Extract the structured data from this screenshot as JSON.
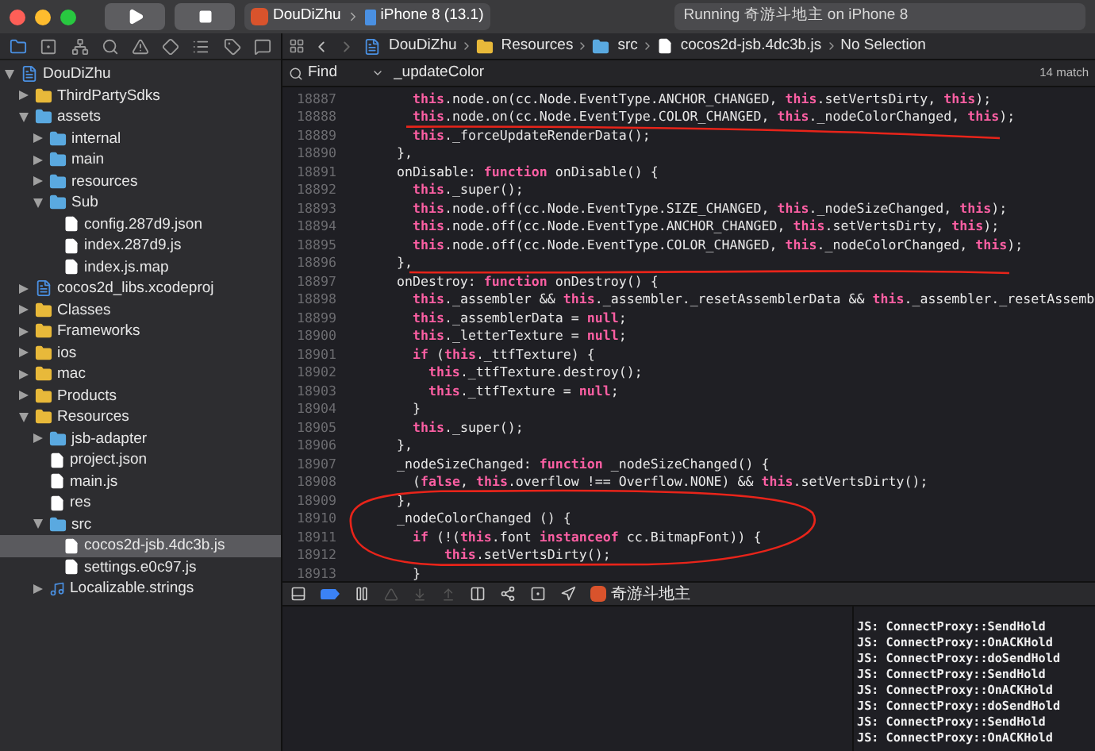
{
  "toolbar": {
    "scheme": "DouDiZhu",
    "device": "iPhone 8 (13.1)",
    "status": "Running 奇游斗地主 on iPhone 8"
  },
  "jump_bar": [
    {
      "kind": "project",
      "label": "DouDiZhu"
    },
    {
      "kind": "group",
      "label": "Resources"
    },
    {
      "kind": "folder",
      "label": "src"
    },
    {
      "kind": "file",
      "label": "cocos2d-jsb.4dc3b.js"
    },
    {
      "kind": "text",
      "label": "No Selection"
    }
  ],
  "find_bar": {
    "mode": "Find",
    "query": "_updateColor",
    "matches": "14 match"
  },
  "navigator": [
    {
      "label": "DouDiZhu",
      "kind": "project",
      "expanded": true,
      "selected": false,
      "children": [
        {
          "label": "ThirdPartySdks",
          "kind": "group",
          "expanded": false,
          "selected": false
        },
        {
          "label": "assets",
          "kind": "folder",
          "expanded": true,
          "selected": false,
          "children": [
            {
              "label": "internal",
              "kind": "folder",
              "expanded": false,
              "selected": false
            },
            {
              "label": "main",
              "kind": "folder",
              "expanded": false,
              "selected": false
            },
            {
              "label": "resources",
              "kind": "folder",
              "expanded": false,
              "selected": false
            },
            {
              "label": "Sub",
              "kind": "folder",
              "expanded": true,
              "selected": false,
              "children": [
                {
                  "label": "config.287d9.json",
                  "kind": "file",
                  "selected": false
                },
                {
                  "label": "index.287d9.js",
                  "kind": "file",
                  "selected": false
                },
                {
                  "label": "index.js.map",
                  "kind": "file",
                  "selected": false
                }
              ]
            }
          ]
        },
        {
          "label": "cocos2d_libs.xcodeproj",
          "kind": "project",
          "expanded": false,
          "selected": false
        },
        {
          "label": "Classes",
          "kind": "group",
          "expanded": false,
          "selected": false
        },
        {
          "label": "Frameworks",
          "kind": "group",
          "expanded": false,
          "selected": false
        },
        {
          "label": "ios",
          "kind": "group",
          "expanded": false,
          "selected": false
        },
        {
          "label": "mac",
          "kind": "group",
          "expanded": false,
          "selected": false
        },
        {
          "label": "Products",
          "kind": "group",
          "expanded": false,
          "selected": false
        },
        {
          "label": "Resources",
          "kind": "group",
          "expanded": true,
          "selected": false,
          "children": [
            {
              "label": "jsb-adapter",
              "kind": "folder",
              "expanded": false,
              "selected": false
            },
            {
              "label": "project.json",
              "kind": "file",
              "selected": false
            },
            {
              "label": "main.js",
              "kind": "file",
              "selected": false
            },
            {
              "label": "res",
              "kind": "file",
              "selected": false
            },
            {
              "label": "src",
              "kind": "folder",
              "expanded": true,
              "selected": false,
              "children": [
                {
                  "label": "cocos2d-jsb.4dc3b.js",
                  "kind": "file",
                  "selected": true
                },
                {
                  "label": "settings.e0c97.js",
                  "kind": "file",
                  "selected": false
                }
              ]
            },
            {
              "label": "Localizable.strings",
              "kind": "strings",
              "expanded": false,
              "selected": false
            }
          ]
        }
      ]
    }
  ],
  "code_lines": [
    {
      "number": "18887",
      "tokens": [
        {
          "kind": "keyword",
          "text": "        this"
        },
        {
          "kind": "plain",
          "text": ".node.on(cc.Node.EventType.ANCHOR_CHANGED, "
        },
        {
          "kind": "keyword",
          "text": "this"
        },
        {
          "kind": "plain",
          "text": ".setVertsDirty, "
        },
        {
          "kind": "keyword",
          "text": "this"
        },
        {
          "kind": "plain",
          "text": ");"
        }
      ]
    },
    {
      "number": "18888",
      "tokens": [
        {
          "kind": "keyword",
          "text": "        this"
        },
        {
          "kind": "plain",
          "text": ".node.on(cc.Node.EventType.COLOR_CHANGED, "
        },
        {
          "kind": "keyword",
          "text": "this"
        },
        {
          "kind": "plain",
          "text": "._nodeColorChanged, "
        },
        {
          "kind": "keyword",
          "text": "this"
        },
        {
          "kind": "plain",
          "text": ");"
        }
      ]
    },
    {
      "number": "18889",
      "tokens": [
        {
          "kind": "keyword",
          "text": "        this"
        },
        {
          "kind": "plain",
          "text": "._forceUpdateRenderData();"
        }
      ]
    },
    {
      "number": "18890",
      "tokens": [
        {
          "kind": "plain",
          "text": "      },"
        }
      ]
    },
    {
      "number": "18891",
      "tokens": [
        {
          "kind": "plain",
          "text": "      onDisable: "
        },
        {
          "kind": "keyword",
          "text": "function"
        },
        {
          "kind": "plain",
          "text": " onDisable() {"
        }
      ]
    },
    {
      "number": "18892",
      "tokens": [
        {
          "kind": "keyword",
          "text": "        this"
        },
        {
          "kind": "plain",
          "text": "._super();"
        }
      ]
    },
    {
      "number": "18893",
      "tokens": [
        {
          "kind": "keyword",
          "text": "        this"
        },
        {
          "kind": "plain",
          "text": ".node.off(cc.Node.EventType.SIZE_CHANGED, "
        },
        {
          "kind": "keyword",
          "text": "this"
        },
        {
          "kind": "plain",
          "text": "._nodeSizeChanged, "
        },
        {
          "kind": "keyword",
          "text": "this"
        },
        {
          "kind": "plain",
          "text": ");"
        }
      ]
    },
    {
      "number": "18894",
      "tokens": [
        {
          "kind": "keyword",
          "text": "        this"
        },
        {
          "kind": "plain",
          "text": ".node.off(cc.Node.EventType.ANCHOR_CHANGED, "
        },
        {
          "kind": "keyword",
          "text": "this"
        },
        {
          "kind": "plain",
          "text": ".setVertsDirty, "
        },
        {
          "kind": "keyword",
          "text": "this"
        },
        {
          "kind": "plain",
          "text": ");"
        }
      ]
    },
    {
      "number": "18895",
      "tokens": [
        {
          "kind": "keyword",
          "text": "        this"
        },
        {
          "kind": "plain",
          "text": ".node.off(cc.Node.EventType.COLOR_CHANGED, "
        },
        {
          "kind": "keyword",
          "text": "this"
        },
        {
          "kind": "plain",
          "text": "._nodeColorChanged, "
        },
        {
          "kind": "keyword",
          "text": "this"
        },
        {
          "kind": "plain",
          "text": ");"
        }
      ]
    },
    {
      "number": "18896",
      "tokens": [
        {
          "kind": "plain",
          "text": "      },"
        }
      ]
    },
    {
      "number": "18897",
      "tokens": [
        {
          "kind": "plain",
          "text": "      onDestroy: "
        },
        {
          "kind": "keyword",
          "text": "function"
        },
        {
          "kind": "plain",
          "text": " onDestroy() {"
        }
      ]
    },
    {
      "number": "18898",
      "tokens": [
        {
          "kind": "keyword",
          "text": "        this"
        },
        {
          "kind": "plain",
          "text": "._assembler && "
        },
        {
          "kind": "keyword",
          "text": "this"
        },
        {
          "kind": "plain",
          "text": "._assembler._resetAssemblerData && "
        },
        {
          "kind": "keyword",
          "text": "this"
        },
        {
          "kind": "plain",
          "text": "._assembler._resetAssemb"
        }
      ]
    },
    {
      "number": "18899",
      "tokens": [
        {
          "kind": "keyword",
          "text": "        this"
        },
        {
          "kind": "plain",
          "text": "._assemblerData = "
        },
        {
          "kind": "keyword",
          "text": "null"
        },
        {
          "kind": "plain",
          "text": ";"
        }
      ]
    },
    {
      "number": "18900",
      "tokens": [
        {
          "kind": "keyword",
          "text": "        this"
        },
        {
          "kind": "plain",
          "text": "._letterTexture = "
        },
        {
          "kind": "keyword",
          "text": "null"
        },
        {
          "kind": "plain",
          "text": ";"
        }
      ]
    },
    {
      "number": "18901",
      "tokens": [
        {
          "kind": "keyword",
          "text": "        if"
        },
        {
          "kind": "plain",
          "text": " ("
        },
        {
          "kind": "keyword",
          "text": "this"
        },
        {
          "kind": "plain",
          "text": "._ttfTexture) {"
        }
      ]
    },
    {
      "number": "18902",
      "tokens": [
        {
          "kind": "keyword",
          "text": "          this"
        },
        {
          "kind": "plain",
          "text": "._ttfTexture.destroy();"
        }
      ]
    },
    {
      "number": "18903",
      "tokens": [
        {
          "kind": "keyword",
          "text": "          this"
        },
        {
          "kind": "plain",
          "text": "._ttfTexture = "
        },
        {
          "kind": "keyword",
          "text": "null"
        },
        {
          "kind": "plain",
          "text": ";"
        }
      ]
    },
    {
      "number": "18904",
      "tokens": [
        {
          "kind": "plain",
          "text": "        }"
        }
      ]
    },
    {
      "number": "18905",
      "tokens": [
        {
          "kind": "keyword",
          "text": "        this"
        },
        {
          "kind": "plain",
          "text": "._super();"
        }
      ]
    },
    {
      "number": "18906",
      "tokens": [
        {
          "kind": "plain",
          "text": "      },"
        }
      ]
    },
    {
      "number": "18907",
      "tokens": [
        {
          "kind": "plain",
          "text": "      _nodeSizeChanged: "
        },
        {
          "kind": "keyword",
          "text": "function"
        },
        {
          "kind": "plain",
          "text": " _nodeSizeChanged() {"
        }
      ]
    },
    {
      "number": "18908",
      "tokens": [
        {
          "kind": "plain",
          "text": "        ("
        },
        {
          "kind": "keyword",
          "text": "false"
        },
        {
          "kind": "plain",
          "text": ", "
        },
        {
          "kind": "keyword",
          "text": "this"
        },
        {
          "kind": "plain",
          "text": ".overflow !== Overflow.NONE) && "
        },
        {
          "kind": "keyword",
          "text": "this"
        },
        {
          "kind": "plain",
          "text": ".setVertsDirty();"
        }
      ]
    },
    {
      "number": "18909",
      "tokens": [
        {
          "kind": "plain",
          "text": "      },"
        }
      ]
    },
    {
      "number": "18910",
      "tokens": [
        {
          "kind": "plain",
          "text": "      _nodeColorChanged () {"
        }
      ]
    },
    {
      "number": "18911",
      "tokens": [
        {
          "kind": "keyword",
          "text": "        if"
        },
        {
          "kind": "plain",
          "text": " (!("
        },
        {
          "kind": "keyword",
          "text": "this"
        },
        {
          "kind": "plain",
          "text": ".font "
        },
        {
          "kind": "keyword",
          "text": "instanceof"
        },
        {
          "kind": "plain",
          "text": " cc.BitmapFont)) {"
        }
      ]
    },
    {
      "number": "18912",
      "tokens": [
        {
          "kind": "keyword",
          "text": "            this"
        },
        {
          "kind": "plain",
          "text": ".setVertsDirty();"
        }
      ]
    },
    {
      "number": "18913",
      "tokens": [
        {
          "kind": "plain",
          "text": "        }"
        }
      ]
    }
  ],
  "debug_bar": {
    "app_name": "奇游斗地主"
  },
  "console_lines": [
    "JS: ConnectProxy::SendHold",
    "JS: ConnectProxy::OnACKHold",
    "JS: ConnectProxy::doSendHold",
    "JS: ConnectProxy::SendHold",
    "JS: ConnectProxy::OnACKHold",
    "JS: ConnectProxy::doSendHold",
    "JS: ConnectProxy::SendHold",
    "JS: ConnectProxy::OnACKHold"
  ]
}
